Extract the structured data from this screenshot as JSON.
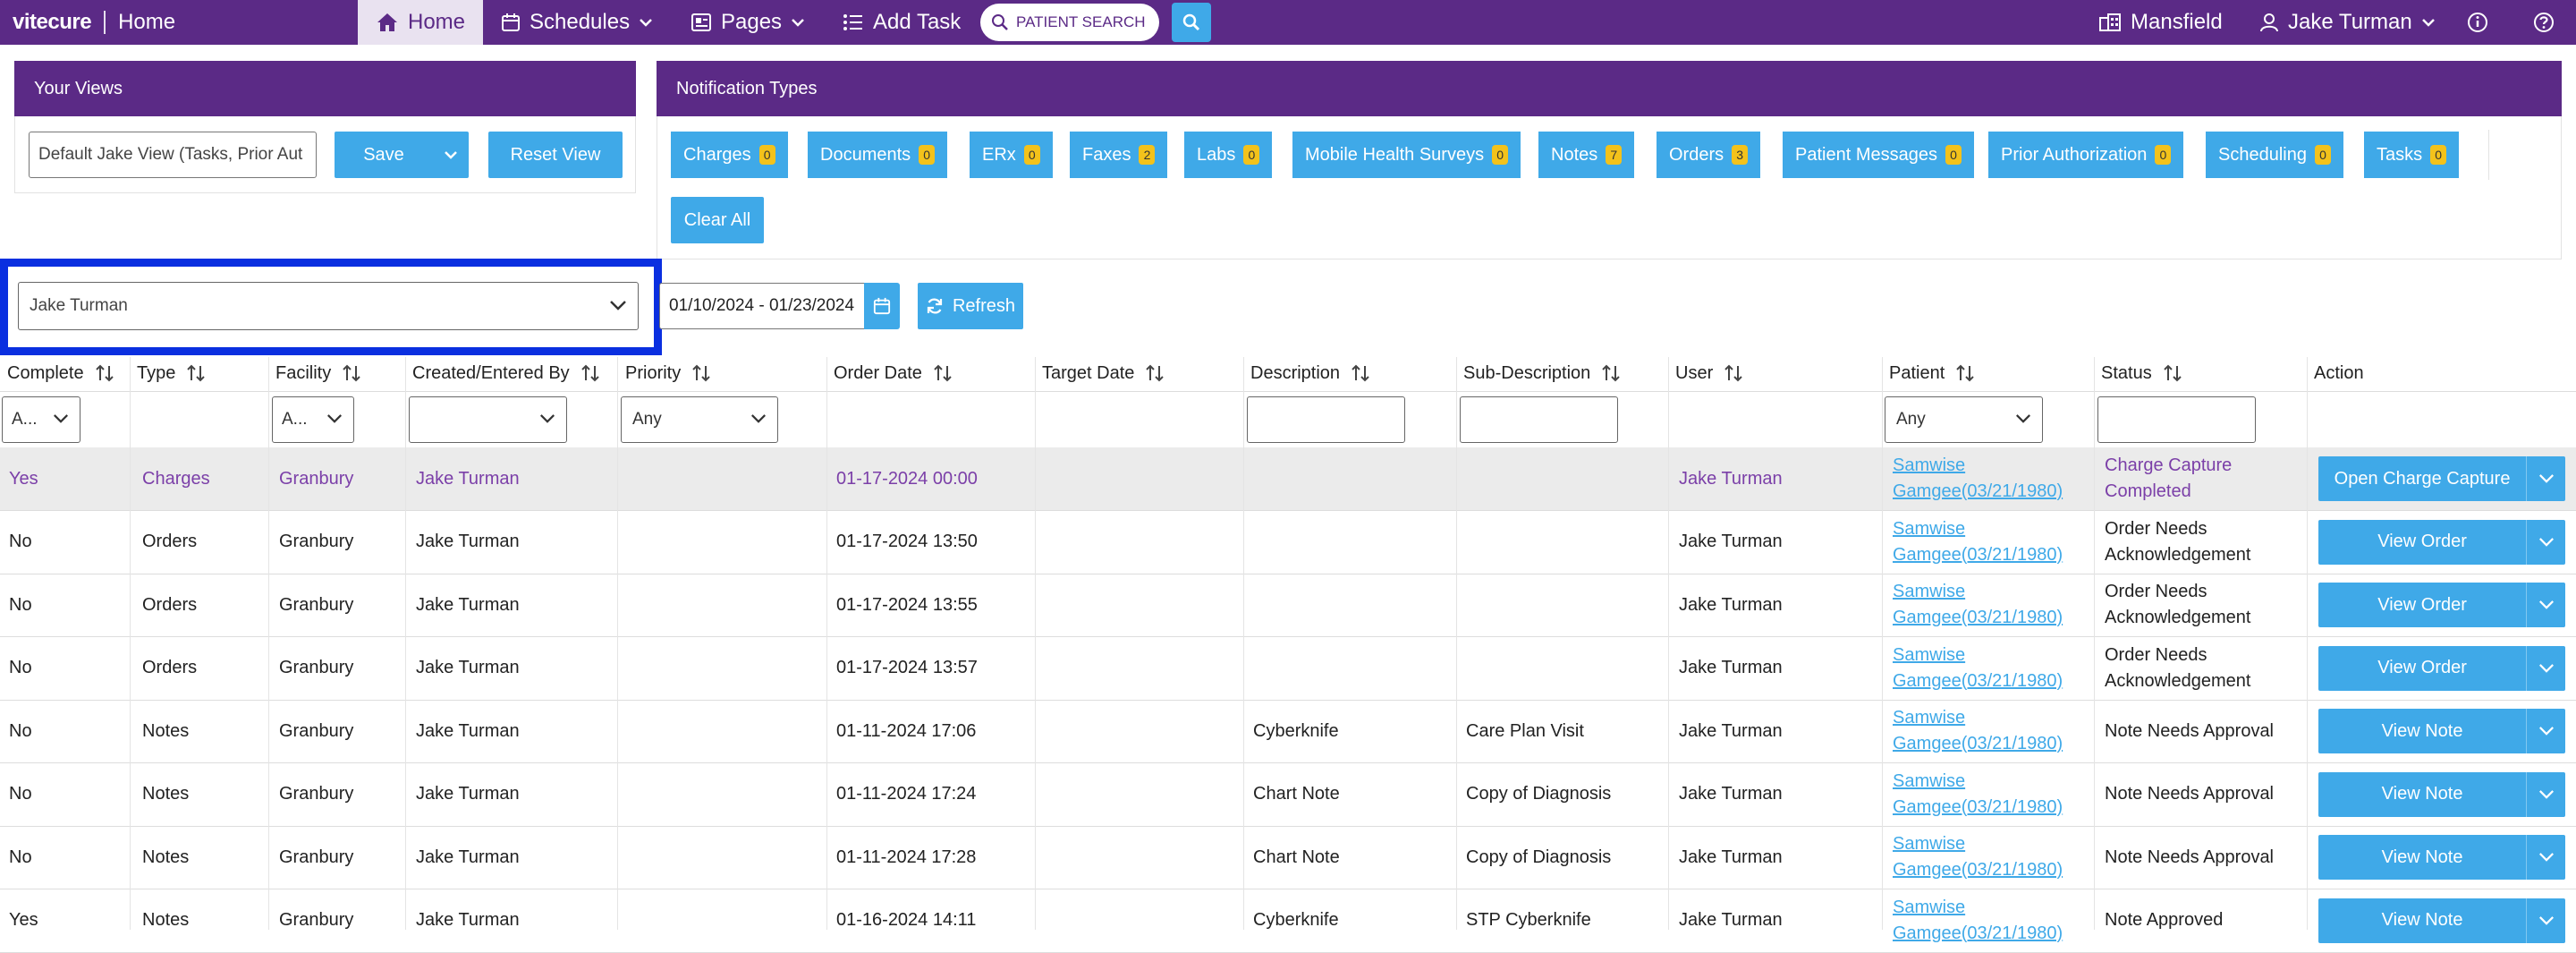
{
  "nav": {
    "brand": "vitecure",
    "page": "Home",
    "items": [
      {
        "label": "Home",
        "icon": "home-icon"
      },
      {
        "label": "Schedules",
        "icon": "calendar-icon"
      },
      {
        "label": "Pages",
        "icon": "pages-icon"
      },
      {
        "label": "Add Task",
        "icon": "task-list-icon"
      }
    ],
    "search_placeholder": "PATIENT SEARCH",
    "location": "Mansfield",
    "user": "Jake Turman"
  },
  "views": {
    "title": "Your Views",
    "current": "Default Jake View (Tasks, Prior Aut",
    "save_label": "Save",
    "reset_label": "Reset View"
  },
  "notifications": {
    "title": "Notification Types",
    "items": [
      {
        "label": "Charges",
        "count": "0"
      },
      {
        "label": "Documents",
        "count": "0"
      },
      {
        "label": "ERx",
        "count": "0"
      },
      {
        "label": "Faxes",
        "count": "2"
      },
      {
        "label": "Labs",
        "count": "0"
      },
      {
        "label": "Mobile Health Surveys",
        "count": "0"
      },
      {
        "label": "Notes",
        "count": "7"
      },
      {
        "label": "Orders",
        "count": "3"
      },
      {
        "label": "Patient Messages",
        "count": "0"
      },
      {
        "label": "Prior Authorization",
        "count": "0"
      },
      {
        "label": "Scheduling",
        "count": "0"
      },
      {
        "label": "Tasks",
        "count": "0"
      }
    ],
    "clear_label": "Clear All"
  },
  "filters": {
    "user": "Jake Turman",
    "date_range": "01/10/2024 - 01/23/2024",
    "refresh_label": "Refresh",
    "complete": "A...",
    "facility": "A...",
    "created_by": "",
    "priority": "Any",
    "patient": "Any"
  },
  "table": {
    "headers": {
      "complete": "Complete",
      "type": "Type",
      "facility": "Facility",
      "created": "Created/Entered By",
      "priority": "Priority",
      "order_date": "Order Date",
      "target_date": "Target Date",
      "description": "Description",
      "sub_description": "Sub-Description",
      "user": "User",
      "patient": "Patient",
      "status": "Status",
      "action": "Action"
    },
    "rows": [
      {
        "complete": "Yes",
        "type": "Charges",
        "facility": "Granbury",
        "created": "Jake Turman",
        "order_date": "01-17-2024 00:00",
        "description": "",
        "sub_description": "",
        "user": "Jake Turman",
        "patient_name": "Samwise",
        "patient_dob": "Gamgee(03/21/1980)",
        "status": "Charge Capture Completed",
        "action": "Open Charge Capture"
      },
      {
        "complete": "No",
        "type": "Orders",
        "facility": "Granbury",
        "created": "Jake Turman",
        "order_date": "01-17-2024 13:50",
        "description": "",
        "sub_description": "",
        "user": "Jake Turman",
        "patient_name": "Samwise",
        "patient_dob": "Gamgee(03/21/1980)",
        "status": "Order Needs Acknowledgement",
        "action": "View Order"
      },
      {
        "complete": "No",
        "type": "Orders",
        "facility": "Granbury",
        "created": "Jake Turman",
        "order_date": "01-17-2024 13:55",
        "description": "",
        "sub_description": "",
        "user": "Jake Turman",
        "patient_name": "Samwise",
        "patient_dob": "Gamgee(03/21/1980)",
        "status": "Order Needs Acknowledgement",
        "action": "View Order"
      },
      {
        "complete": "No",
        "type": "Orders",
        "facility": "Granbury",
        "created": "Jake Turman",
        "order_date": "01-17-2024 13:57",
        "description": "",
        "sub_description": "",
        "user": "Jake Turman",
        "patient_name": "Samwise",
        "patient_dob": "Gamgee(03/21/1980)",
        "status": "Order Needs Acknowledgement",
        "action": "View Order"
      },
      {
        "complete": "No",
        "type": "Notes",
        "facility": "Granbury",
        "created": "Jake Turman",
        "order_date": "01-11-2024 17:06",
        "description": "Cyberknife",
        "sub_description": "Care Plan Visit",
        "user": "Jake Turman",
        "patient_name": "Samwise",
        "patient_dob": "Gamgee(03/21/1980)",
        "status": "Note Needs Approval",
        "action": "View Note"
      },
      {
        "complete": "No",
        "type": "Notes",
        "facility": "Granbury",
        "created": "Jake Turman",
        "order_date": "01-11-2024 17:24",
        "description": "Chart Note",
        "sub_description": "Copy of Diagnosis",
        "user": "Jake Turman",
        "patient_name": "Samwise",
        "patient_dob": "Gamgee(03/21/1980)",
        "status": "Note Needs Approval",
        "action": "View Note"
      },
      {
        "complete": "No",
        "type": "Notes",
        "facility": "Granbury",
        "created": "Jake Turman",
        "order_date": "01-11-2024 17:28",
        "description": "Chart Note",
        "sub_description": "Copy of Diagnosis",
        "user": "Jake Turman",
        "patient_name": "Samwise",
        "patient_dob": "Gamgee(03/21/1980)",
        "status": "Note Needs Approval",
        "action": "View Note"
      },
      {
        "complete": "Yes",
        "type": "Notes",
        "facility": "Granbury",
        "created": "Jake Turman",
        "order_date": "01-16-2024 14:11",
        "description": "Cyberknife",
        "sub_description": "STP Cyberknife",
        "user": "Jake Turman",
        "patient_name": "Samwise",
        "patient_dob": "Gamgee(03/21/1980)",
        "status": "Note Approved",
        "action": "View Note"
      }
    ]
  },
  "colors": {
    "nav": "#5b2a86",
    "accent": "#3fa9e8",
    "badge": "#f3c21b",
    "highlight": "#0a2fe0"
  }
}
